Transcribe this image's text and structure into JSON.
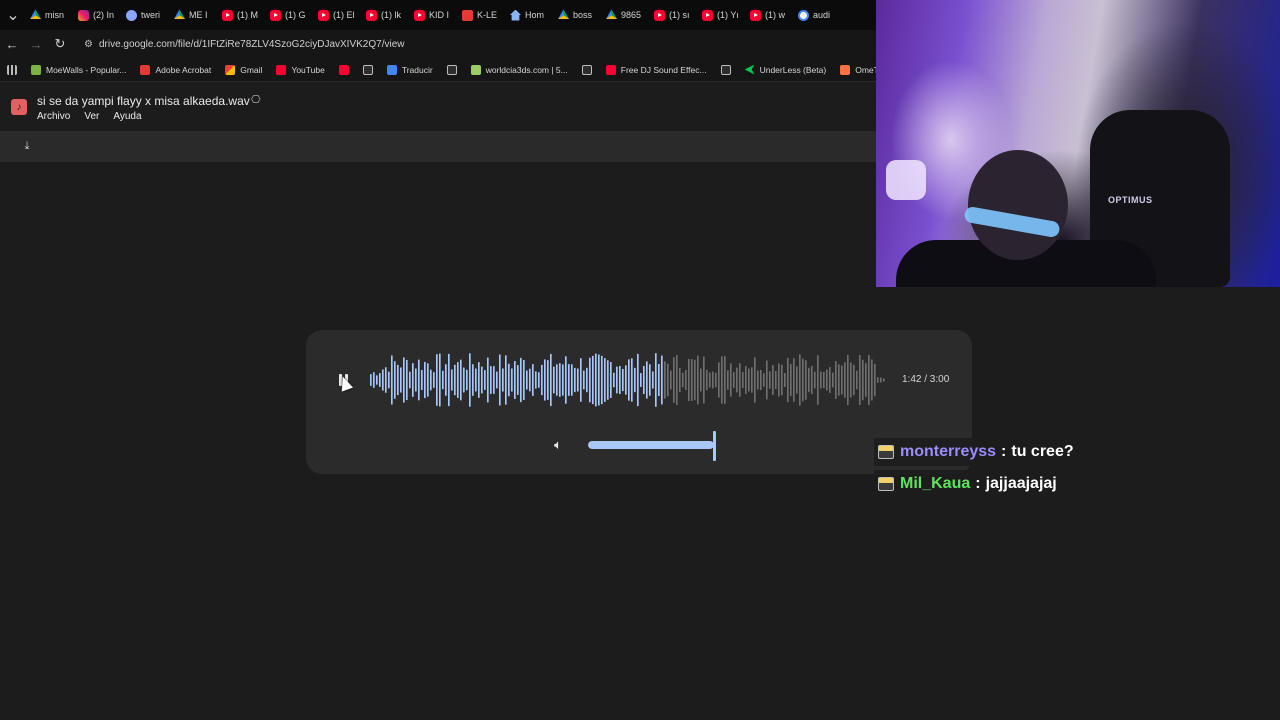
{
  "browser": {
    "tabs": [
      {
        "label": "misn",
        "icon": "drive-icon"
      },
      {
        "label": "(2) In",
        "icon": "instagram-icon"
      },
      {
        "label": "tweri",
        "icon": "twitch-icon"
      },
      {
        "label": "ME I",
        "icon": "drive-icon"
      },
      {
        "label": "(1) M",
        "icon": "youtube-icon"
      },
      {
        "label": "(1) G",
        "icon": "youtube-icon"
      },
      {
        "label": "(1) El",
        "icon": "youtube-icon"
      },
      {
        "label": "(1) lk",
        "icon": "youtube-icon"
      },
      {
        "label": "KID I",
        "icon": "youtube-icon"
      },
      {
        "label": "K-LE",
        "icon": "kle-icon"
      },
      {
        "label": "Hom",
        "icon": "home-icon"
      },
      {
        "label": "boss",
        "icon": "drive-icon"
      },
      {
        "label": "9865",
        "icon": "drive-icon"
      },
      {
        "label": "(1) sı",
        "icon": "youtube-icon"
      },
      {
        "label": "(1) Yı",
        "icon": "youtube-icon"
      },
      {
        "label": "(1) w",
        "icon": "youtube-icon"
      },
      {
        "label": "audi",
        "icon": "google-icon"
      }
    ],
    "url": "drive.google.com/file/d/1IFtZiRe78ZLV4SzoG2ciyDJavXIVK2Q7/view",
    "bookmarks": [
      {
        "label": "MoeWalls - Popular...",
        "icon": "moewalls-icon"
      },
      {
        "label": "Adobe Acrobat",
        "icon": "adobe-icon"
      },
      {
        "label": "Gmail",
        "icon": "gmail-icon"
      },
      {
        "label": "YouTube",
        "icon": "youtube-icon"
      },
      {
        "label": "",
        "icon": "youtube-icon"
      },
      {
        "label": "",
        "icon": "globe-icon"
      },
      {
        "label": "Traducir",
        "icon": "translate-icon"
      },
      {
        "label": "",
        "icon": "globe-icon"
      },
      {
        "label": "worldcia3ds.com | 5...",
        "icon": "worldcia-icon"
      },
      {
        "label": "",
        "icon": "globe-icon"
      },
      {
        "label": "Free DJ Sound Effec...",
        "icon": "youtube-icon"
      },
      {
        "label": "",
        "icon": "globe-icon"
      },
      {
        "label": "UnderLess (Beta)",
        "icon": "underless-icon"
      },
      {
        "label": "OmeTV Video Chat...",
        "icon": "ometv-icon"
      }
    ]
  },
  "drive": {
    "file_title": "si se da yampi flayy x misa alkaeda.wav",
    "menu": [
      "Archivo",
      "Ver",
      "Ayuda"
    ]
  },
  "player": {
    "state": "playing",
    "time": "1:42 / 3:00",
    "progress": 0.567,
    "volume": 1.0,
    "colors": {
      "played": "#a8c7fa",
      "unplayed": "#6f6f6f",
      "card": "#2b2b2b"
    }
  },
  "chat": [
    {
      "user": "monterreyss",
      "sep": ":",
      "message": "tu cree?",
      "color": "#9b8cff"
    },
    {
      "user": "Mil_Kaua",
      "sep": ":",
      "message": "jajjaajajaj",
      "color": "#5fe35f"
    }
  ],
  "webcam": {
    "logo_text": "OPTIMUS"
  }
}
